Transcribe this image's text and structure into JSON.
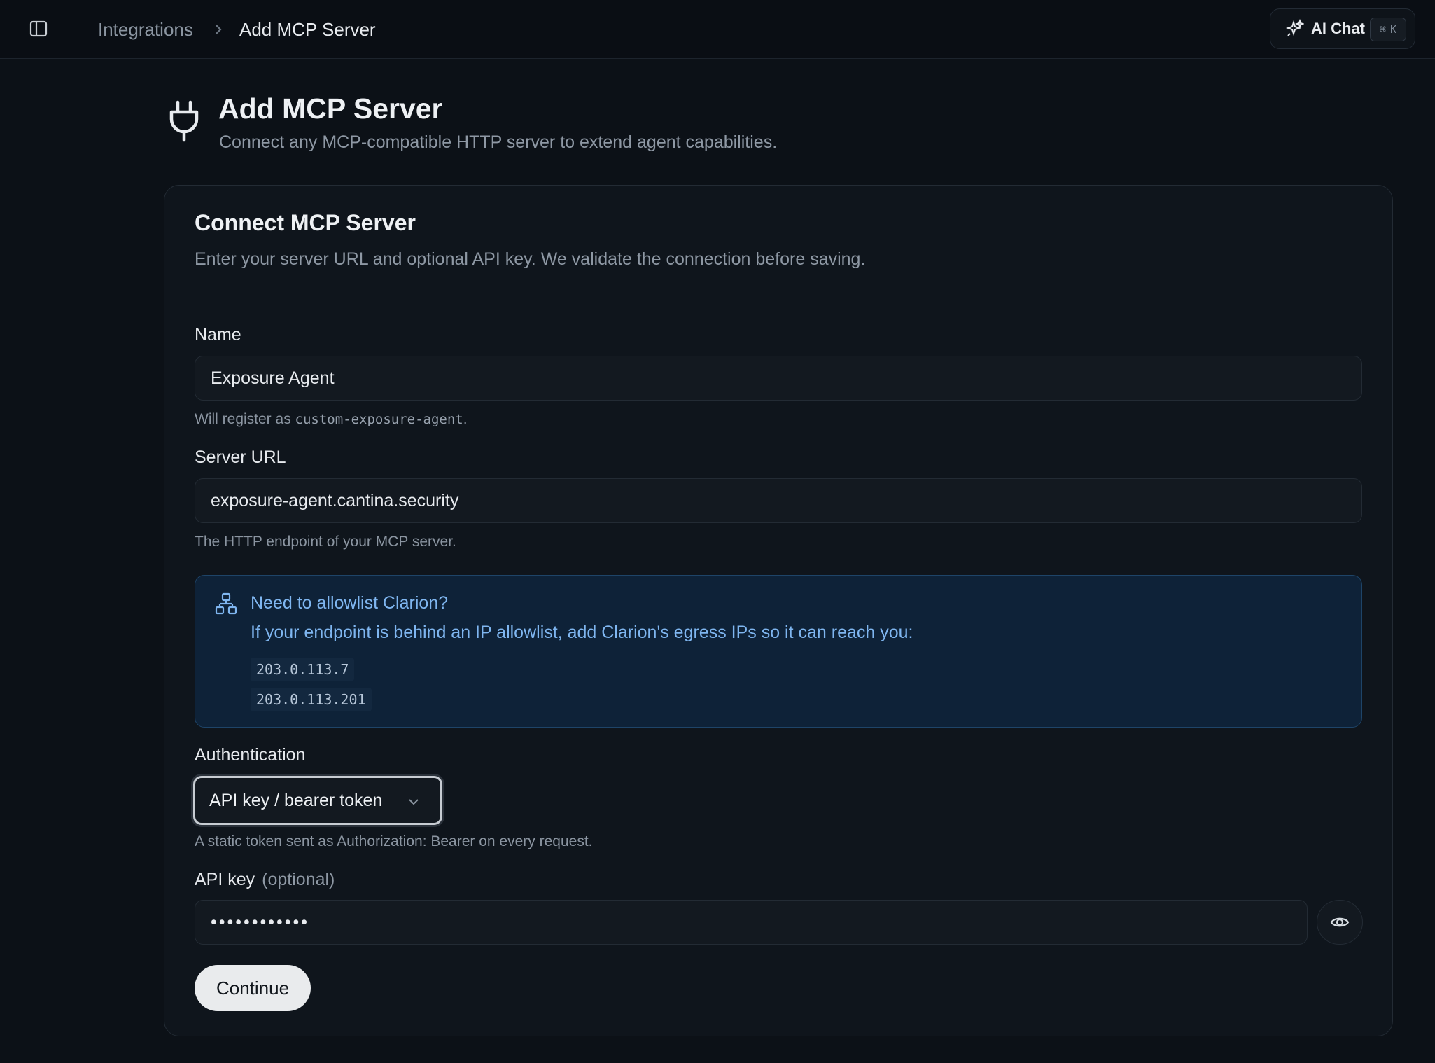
{
  "breadcrumb": {
    "parent": "Integrations",
    "current": "Add MCP Server"
  },
  "ai_chat": {
    "label": "AI Chat",
    "kbd_mod": "⌘",
    "kbd_key": "K"
  },
  "header": {
    "title": "Add MCP Server",
    "subtitle": "Connect any MCP-compatible HTTP server to extend agent capabilities."
  },
  "card": {
    "title": "Connect MCP Server",
    "description": "Enter your server URL and optional API key. We validate the connection before saving."
  },
  "form": {
    "name": {
      "label": "Name",
      "value": "Exposure Agent",
      "hint_prefix": "Will register as ",
      "hint_code": "custom-exposure-agent",
      "hint_suffix": "."
    },
    "server_url": {
      "label": "Server URL",
      "value": "exposure-agent.cantina.security",
      "hint": "The HTTP endpoint of your MCP server."
    },
    "allowlist": {
      "title": "Need to allowlist Clarion?",
      "text": "If your endpoint is behind an IP allowlist, add Clarion's egress IPs so it can reach you:",
      "ips": [
        "203.0.113.7",
        "203.0.113.201"
      ]
    },
    "authentication": {
      "label": "Authentication",
      "selected": "API key / bearer token",
      "hint": "A static token sent as Authorization: Bearer on every request."
    },
    "api_key": {
      "label": "API key",
      "optional": "(optional)",
      "value": "••••••••••••"
    },
    "continue_label": "Continue"
  },
  "colors": {
    "background": "#0c1117",
    "card": "#0f151c",
    "info_bg": "#0e2238",
    "info_text": "#7fb6f0",
    "button_bg": "#e9ebed"
  }
}
